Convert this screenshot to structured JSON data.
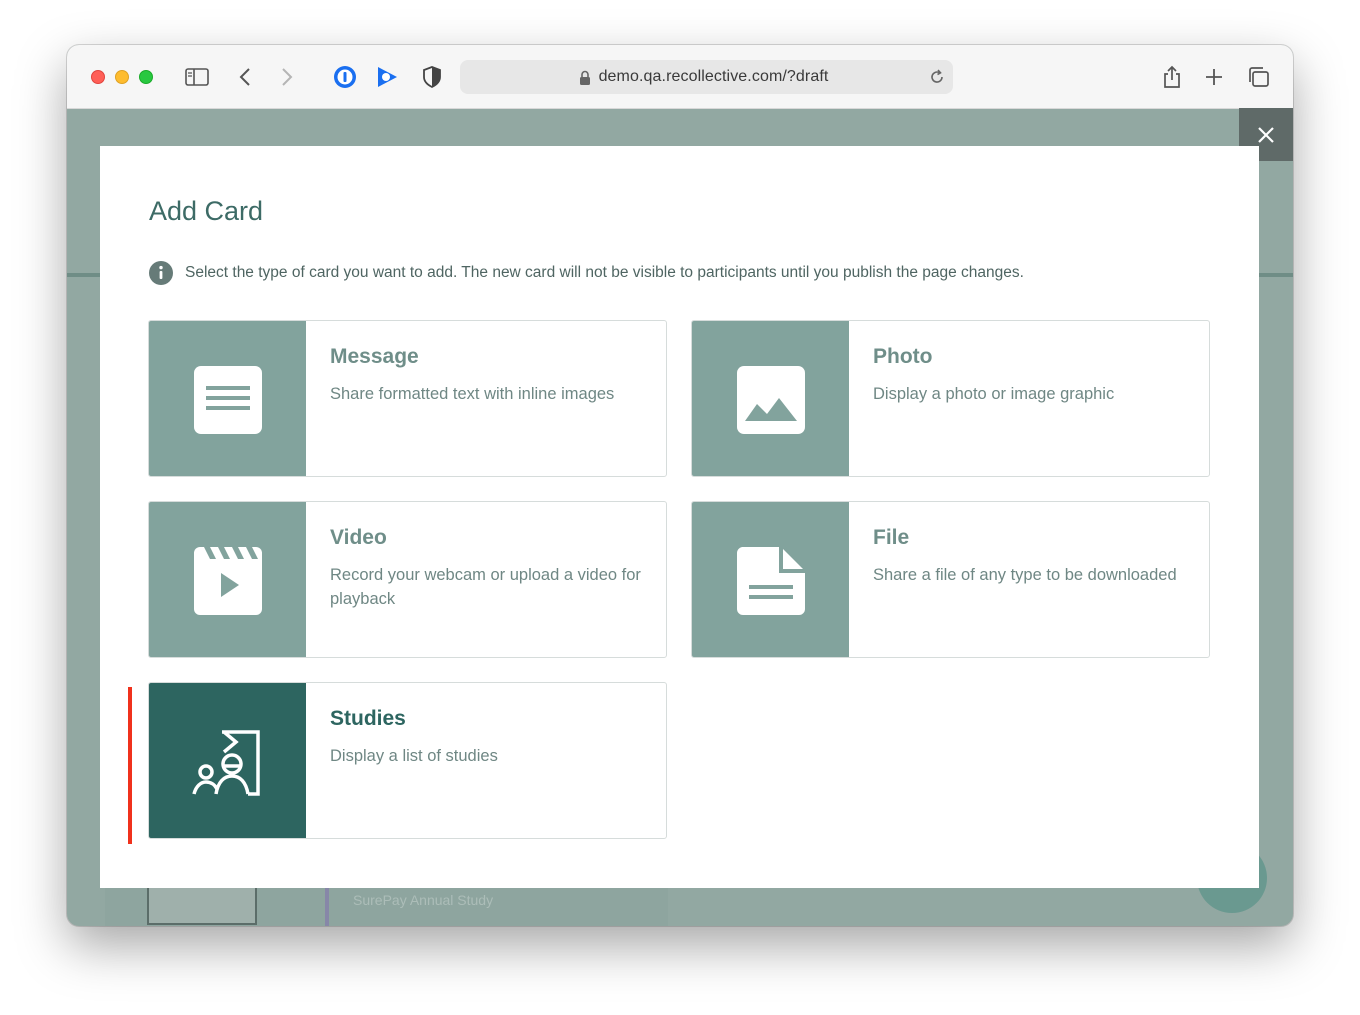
{
  "browser": {
    "url": "demo.qa.recollective.com/?draft",
    "icons": [
      "sidebar-icon",
      "back-icon",
      "forward-icon",
      "password-manager-icon",
      "extension-icon",
      "privacy-shield-icon",
      "lock-icon",
      "reload-icon",
      "share-icon",
      "new-tab-icon",
      "tab-overview-icon"
    ]
  },
  "background": {
    "study_text": "SurePay Annual Study"
  },
  "modal": {
    "title": "Add Card",
    "notice": "Select the type of card you want to add. The new card will not be visible to participants until you publish the page changes."
  },
  "cards": [
    {
      "title": "Message",
      "description": "Share formatted text with inline images",
      "icon": "message-icon"
    },
    {
      "title": "Photo",
      "description": "Display a photo or image graphic",
      "icon": "photo-icon"
    },
    {
      "title": "Video",
      "description": "Record your webcam or upload a video for playback",
      "icon": "video-icon"
    },
    {
      "title": "File",
      "description": "Share a file of any type to be downloaded",
      "icon": "file-icon"
    },
    {
      "title": "Studies",
      "description": "Display a list of studies",
      "icon": "studies-icon",
      "selected": true
    }
  ],
  "colors": {
    "accent_dark": "#2d6560",
    "icon_panel": "#82a39d",
    "highlight": "#f0311c"
  }
}
